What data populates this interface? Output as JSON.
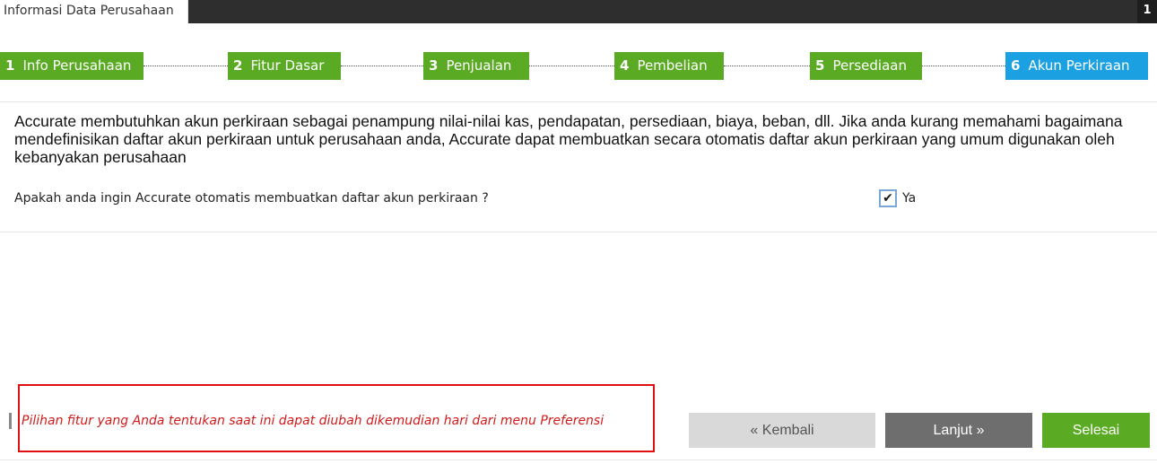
{
  "window": {
    "tab_title": "Informasi Data Perusahaan",
    "tab_badge": "1"
  },
  "steps": [
    {
      "num": "1",
      "label": "Info Perusahaan",
      "active": false
    },
    {
      "num": "2",
      "label": "Fitur Dasar",
      "active": false
    },
    {
      "num": "3",
      "label": "Penjualan",
      "active": false
    },
    {
      "num": "4",
      "label": "Pembelian",
      "active": false
    },
    {
      "num": "5",
      "label": "Persediaan",
      "active": false
    },
    {
      "num": "6",
      "label": "Akun Perkiraan",
      "active": true
    }
  ],
  "content": {
    "description": "Accurate membutuhkan akun perkiraan sebagai penampung nilai-nilai kas, pendapatan, persediaan, biaya, beban, dll. Jika anda kurang memahami bagaimana mendefinisikan daftar akun perkiraan untuk perusahaan anda, Accurate dapat membuatkan secara otomatis daftar akun perkiraan yang umum digunakan oleh kebanyakan perusahaan",
    "question": "Apakah anda ingin Accurate otomatis membuatkan daftar akun perkiraan ?",
    "checkbox_label": "Ya",
    "checkbox_checked": true,
    "checkbox_mark": "✔"
  },
  "footer": {
    "note": "Pilihan fitur yang Anda tentukan saat ini dapat diubah dikemudian hari dari menu Preferensi",
    "back_label": "« Kembali",
    "next_label": "Lanjut »",
    "finish_label": "Selesai"
  },
  "colors": {
    "step_done": "#5aab23",
    "step_active": "#1ba1e2",
    "note_text": "#d11a1a",
    "note_border": "#e01010"
  }
}
